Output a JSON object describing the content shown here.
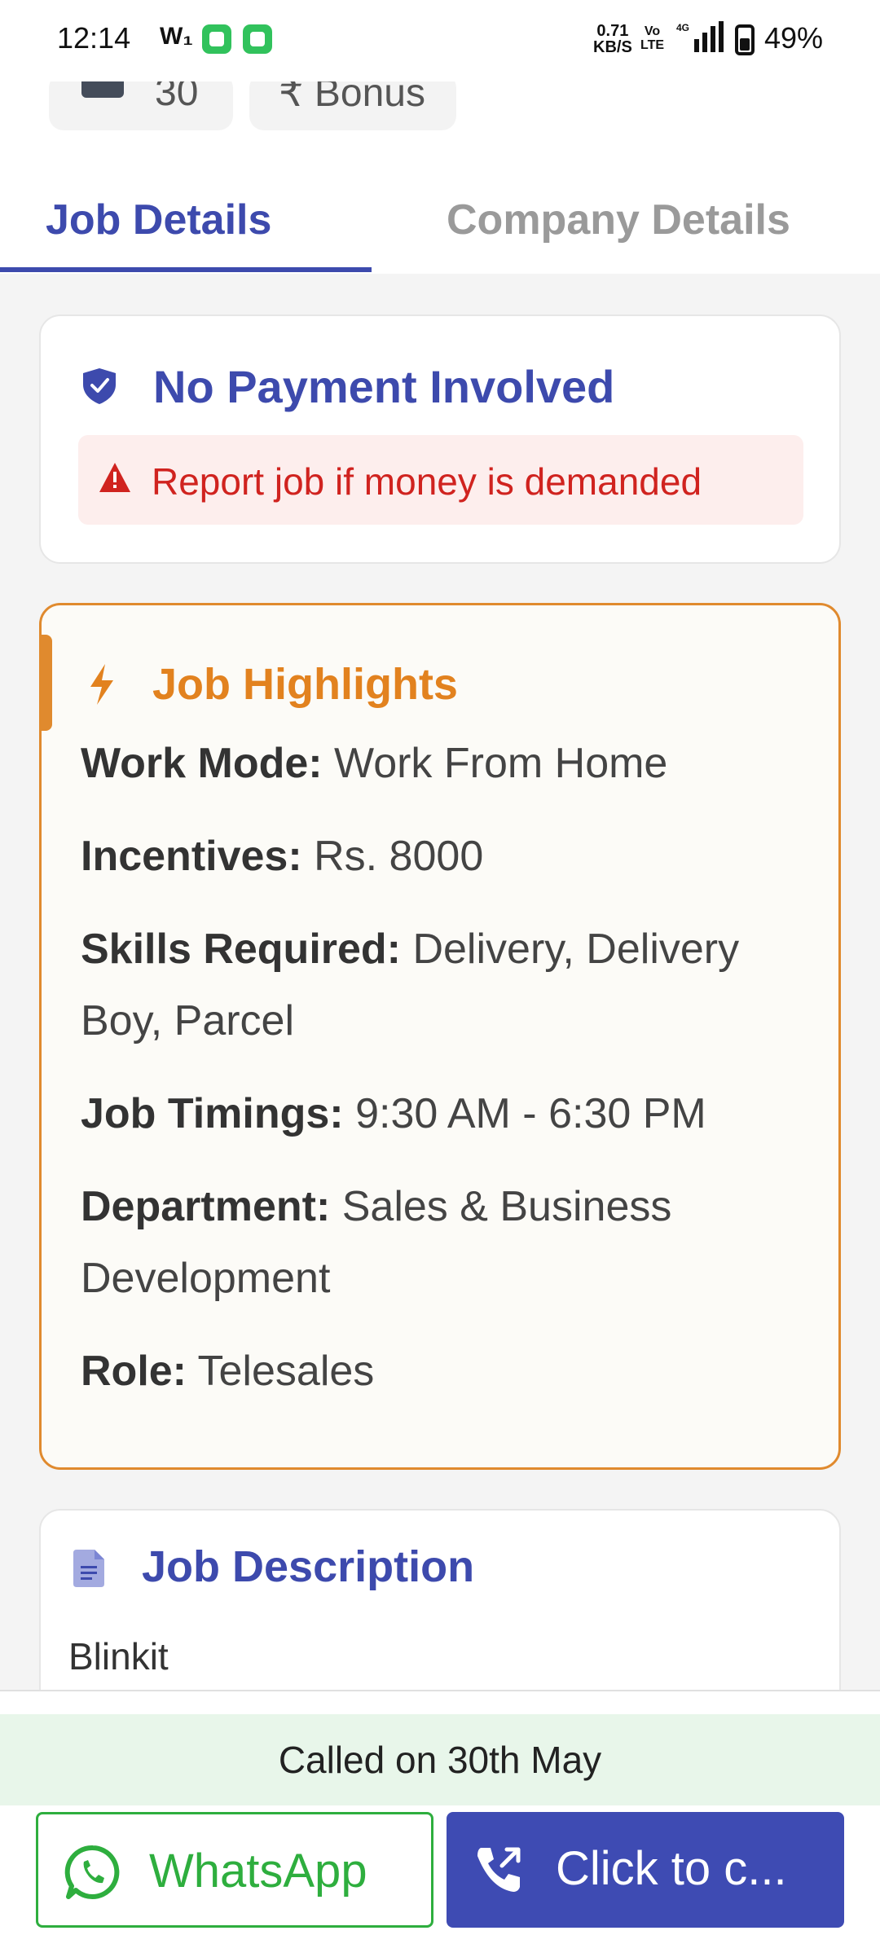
{
  "status_bar": {
    "time": "12:14",
    "wifi_label": "W₁",
    "speed_value": "0.71",
    "speed_unit": "KB/S",
    "volte_top": "Vo",
    "volte_bottom": "LTE",
    "network": "4G",
    "battery": "49%"
  },
  "chips": [
    {
      "label": "30",
      "icon": "rect-icon"
    },
    {
      "label": "₹ Bonus",
      "icon": ""
    }
  ],
  "tabs": [
    {
      "label": "Job Details",
      "active": true
    },
    {
      "label": "Company Details",
      "active": false
    }
  ],
  "safety": {
    "title": "No Payment Involved",
    "warning": "Report job if money is demanded",
    "icon": "shield-icon",
    "warning_icon": "warning-icon"
  },
  "highlights": {
    "title": "Job Highlights",
    "icon": "bolt-icon",
    "items": [
      {
        "key": "Work Mode:",
        "value": "Work From Home"
      },
      {
        "key": "Incentives:",
        "value": "Rs. 8000"
      },
      {
        "key": "Skills Required:",
        "value": "Delivery, Delivery Boy, Parcel"
      },
      {
        "key": "Job Timings:",
        "value": "9:30 AM - 6:30 PM"
      },
      {
        "key": "Department:",
        "value": "Sales & Business Development"
      },
      {
        "key": "Role:",
        "value": "Telesales"
      }
    ]
  },
  "description": {
    "title": "Job Description",
    "icon": "document-icon",
    "text": "Blinkit"
  },
  "footer": {
    "called_text": "Called on 30th May",
    "whatsapp_label": "WhatsApp",
    "call_label": "Click to c...",
    "colors": {
      "whatsapp": "#2eae3e",
      "call": "#3e4bb3",
      "accent_blue": "#3d4aad",
      "accent_orange": "#e08a2e"
    }
  }
}
